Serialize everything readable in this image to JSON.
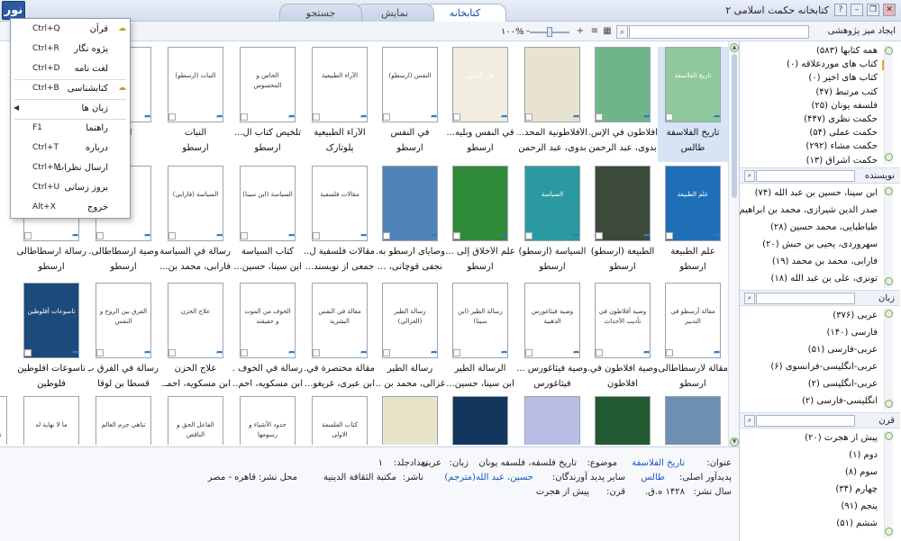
{
  "app": {
    "title": "کتابخانه حکمت اسلامی ۲",
    "logo": "نور",
    "tabs": [
      {
        "label": "کتابخانه",
        "active": true
      },
      {
        "label": "نمایش",
        "active": false
      },
      {
        "label": "جستجو",
        "active": false
      }
    ],
    "window_buttons": [
      "?",
      "–",
      "❐",
      "✕"
    ]
  },
  "toolbar": {
    "title": "ایجاد میز پژوهشی",
    "zoom_label": "۱۰۰%",
    "zoom_level": 0.5,
    "search_placeholder": ""
  },
  "books": [
    [
      {
        "title": "تاریخ الفلاسفة",
        "author": "طالس",
        "cover": "#8fc89a",
        "cover_text": "تاريخ الفلاسفة",
        "selected": true
      },
      {
        "title": "أفلاطون في الإس...",
        "author": "بدوی، عبد الرحمن",
        "cover": "#6fb58a",
        "cover_text": "",
        "selected": false
      },
      {
        "title": "الأفلاطونية المحد...",
        "author": "بدوی، عبد الرحمن",
        "cover": "#e8e2d0",
        "cover_text": "",
        "selected": false
      },
      {
        "title": "في النفس وبليه...",
        "author": "ارسطو",
        "cover": "#f1ede0",
        "cover_text": "في النفس",
        "selected": false
      },
      {
        "title": "في النفس",
        "author": "ارسطو",
        "cover": "#ffffff",
        "cover_text": "النفس (ارسطو)",
        "selected": false
      },
      {
        "title": "الآراء الطبیعیة",
        "author": "پلوتارک",
        "cover": "#ffffff",
        "cover_text": "الآراء الطبيعية",
        "selected": false
      },
      {
        "title": "تلخیص کتاب ال...",
        "author": "ارسطو",
        "cover": "#ffffff",
        "cover_text": "الحاس و المحسوس",
        "selected": false
      },
      {
        "title": "النبات",
        "author": "ارسطو",
        "cover": "#ffffff",
        "cover_text": "النبات (ارسطو)",
        "selected": false
      },
      {
        "title": "أرسـ",
        "author": "بدو",
        "cover": "#ffffff",
        "cover_text": "",
        "selected": false
      }
    ],
    [
      {
        "title": "علم الطبیعة",
        "author": "ارسطو",
        "cover": "#1f6fb8",
        "cover_text": "علم الطبيعة",
        "selected": false
      },
      {
        "title": "الطبیعة (أرسطو)",
        "author": "ارسطو",
        "cover": "#3c4a3a",
        "cover_text": "",
        "selected": false
      },
      {
        "title": "السیاسة (أرسطو)",
        "author": "ارسطو",
        "cover": "#2a9aa0",
        "cover_text": "السياسة",
        "selected": false
      },
      {
        "title": "علم الأخلاق إلى ...",
        "author": "ارسطو",
        "cover": "#2f8a3a",
        "cover_text": "",
        "selected": false
      },
      {
        "title": "وصایای ارسطو به...",
        "author": "نجفی قوچانی، ...",
        "cover": "#4f84b8",
        "cover_text": "",
        "selected": false
      },
      {
        "title": "مقالات فلسفیة ل...",
        "author": "جمعی از نویسند...",
        "cover": "#ffffff",
        "cover_text": "مقالات فلسفية",
        "selected": false
      },
      {
        "title": "کتاب السیاسة",
        "author": "ابن سینا، حسین...",
        "cover": "#ffffff",
        "cover_text": "السياسة (ابن سينا)",
        "selected": false
      },
      {
        "title": "رسالة في السیاسة",
        "author": "فارابی، محمد بن...",
        "cover": "#ffffff",
        "cover_text": "السياسة (فارابي)",
        "selected": false
      },
      {
        "title": "وصیة ارسطاطالی...",
        "author": "ارسطو",
        "cover": "#ffffff",
        "cover_text": "",
        "selected": false
      },
      {
        "title": "رسالة ارسطاطالی...",
        "author": "ارسطو",
        "cover": "#ffffff",
        "cover_text": "",
        "selected": false
      }
    ],
    [
      {
        "title": "مقالة لارسطاطالی...",
        "author": "ارسطو",
        "cover": "#ffffff",
        "cover_text": "مقالة أرسطو في التدبير",
        "selected": false
      },
      {
        "title": "وصیة افلاطون في...",
        "author": "افلاطون",
        "cover": "#ffffff",
        "cover_text": "وصية أفلاطون في تأديب الأحداث",
        "selected": false
      },
      {
        "title": "وصیة فیثاغورس ...",
        "author": "فیثاغورس",
        "cover": "#ffffff",
        "cover_text": "وصية فيثاغورس الذهبية",
        "selected": false
      },
      {
        "title": "الرسالة الطیر",
        "author": "ابن سینا، حسین...",
        "cover": "#ffffff",
        "cover_text": "رسالة الطير (ابن سينا)",
        "selected": false
      },
      {
        "title": "رسالة الطیر",
        "author": "غزالی، محمد بن ...",
        "cover": "#ffffff",
        "cover_text": "رسالة الطير (الغزالي)",
        "selected": false
      },
      {
        "title": "مقالة مختصرة في...",
        "author": "ابن عبری، غریغو...",
        "cover": "#ffffff",
        "cover_text": "مقالة في النفس البشرية",
        "selected": false
      },
      {
        "title": "رسالة في الخوف ...",
        "author": "ابن مسکویه، احم...",
        "cover": "#ffffff",
        "cover_text": "الخوف من الموت و حقيقته",
        "selected": false
      },
      {
        "title": "علاج الحزن",
        "author": "ابن مسکویه، احمـ...",
        "cover": "#ffffff",
        "cover_text": "علاج الحزن",
        "selected": false
      },
      {
        "title": "رسالة في الفرق ب...",
        "author": "قسطا بن لوقا",
        "cover": "#ffffff",
        "cover_text": "الفرق بين الروح و النفس",
        "selected": false
      },
      {
        "title": "تاسوعات أفلوطین",
        "author": "فلوطین",
        "cover": "#1c4a7a",
        "cover_text": "تاسوعات أفلوطين",
        "selected": false
      }
    ],
    [
      {
        "title": "",
        "author": "",
        "cover": "#6f8fb0",
        "cover_text": "",
        "selected": false
      },
      {
        "title": "",
        "author": "",
        "cover": "#235a32",
        "cover_text": "",
        "selected": false
      },
      {
        "title": "",
        "author": "",
        "cover": "#b9bde6",
        "cover_text": "",
        "selected": false
      },
      {
        "title": "",
        "author": "",
        "cover": "#13365e",
        "cover_text": "",
        "selected": false
      },
      {
        "title": "",
        "author": "",
        "cover": "#e9e3c9",
        "cover_text": "",
        "selected": false
      },
      {
        "title": "",
        "author": "",
        "cover": "#ffffff",
        "cover_text": "كتاب الفلسفة الاولى",
        "selected": false
      },
      {
        "title": "",
        "author": "",
        "cover": "#ffffff",
        "cover_text": "حدود الأشياء و رسومها",
        "selected": false
      },
      {
        "title": "",
        "author": "",
        "cover": "#ffffff",
        "cover_text": "الفاعل الحق و الناقص",
        "selected": false
      },
      {
        "title": "",
        "author": "",
        "cover": "#ffffff",
        "cover_text": "تناهي جرم العالم",
        "selected": false
      },
      {
        "title": "",
        "author": "",
        "cover": "#ffffff",
        "cover_text": "ما لا نهاية له",
        "selected": false
      },
      {
        "title": "",
        "author": "",
        "cover": "#ffffff",
        "cover_text": "وحدانية الله و تناهي جرم العالم",
        "selected": false
      }
    ]
  ],
  "details": {
    "title_label": "عنوان:",
    "title_value": "تاریخ الفلاسفة",
    "subject_label": "موضوع:",
    "subject_value": "تاریخ فلسفه، فلسفه یونان",
    "lang_label": "زبان:",
    "lang_value": "عربی",
    "author_label": "پدیدآور اصلی:",
    "author_value": "طالس",
    "other_label": "سایر پدید آورندگان:",
    "other_value": "حسین، عبد الله(مترجم)",
    "publisher_label": "ناشر:",
    "publisher_value": "مکتبة الثقافة الدینیة",
    "place_label": "محل نشر:",
    "place_value": "قاهره - مصر",
    "volumes_label": "تعدادجلد:",
    "volumes_value": "۱",
    "year_label": "سال نشر:",
    "year_value": "۱۴۲۸ ه.ق.",
    "century_label": "قرن:",
    "century_value": "پیش از هجرت"
  },
  "right_panel": {
    "collections": [
      {
        "label": "همه کتابها (۵۸۳)",
        "icon": "books-icon"
      },
      {
        "label": "کتاب های موردعلاقه (۰)",
        "icon": "star-icon"
      },
      {
        "label": "کتاب های اخیر (۰)",
        "icon": "recent-icon"
      },
      {
        "label": "کتب مرتبط (۴۷)",
        "icon": "related-icon"
      },
      {
        "label": "فلسفه یونان (۲۵)",
        "icon": "book-icon"
      },
      {
        "label": "حکمت نظری (۴۴۷)",
        "icon": "book-icon"
      },
      {
        "label": "حکمت عملی (۵۴)",
        "icon": "book-icon"
      },
      {
        "label": "حکمت مشاء (۲۹۲)",
        "icon": "book-icon"
      },
      {
        "label": "حکمت اشراق (۱۳)",
        "icon": "book-icon"
      }
    ],
    "author_header": "نویسنده",
    "authors": [
      "ابن سینا، حسین بن عبد الله (۷۴)",
      "صدر الدین شیرازی، محمد بن ابراهیم",
      "طباطبایی، محمد حسین (۲۸)",
      "سهروردی، یحیی بن حبش (۲۰)",
      "فارابی، محمد بن محمد (۱۹)",
      "تونزی، علی بن عبد الله (۱۸)"
    ],
    "lang_header": "زبان",
    "languages": [
      "عربی (۳۷۶)",
      "فارسی (۱۴۰)",
      "عربی-فارسی (۵۱)",
      "عربی-انگلیسی-فرانسوی (۶)",
      "عربی-انگلیسی (۲)",
      "انگلیسی-فارسی (۲)"
    ],
    "century_header": "قرن",
    "centuries": [
      "پیش از هجرت (۲۰)",
      "دوم (۱)",
      "سوم (۸)",
      "چهارم (۳۴)",
      "پنجم (۹۱)",
      "ششم (۵۱)"
    ]
  },
  "menu": {
    "items": [
      {
        "label": "قرآن",
        "shortcut": "Ctrl+Q",
        "icon": "quran-icon",
        "submenu": false
      },
      {
        "label": "پژوه نگار",
        "shortcut": "Ctrl+R",
        "icon": "",
        "submenu": false
      },
      {
        "label": "لغت نامه",
        "shortcut": "Ctrl+D",
        "icon": "",
        "submenu": false
      },
      {
        "label": "کتابشناسی",
        "shortcut": "Ctrl+B",
        "icon": "bibliography-icon",
        "submenu": false
      },
      {
        "label": "زبان ها",
        "shortcut": "",
        "icon": "",
        "submenu": true
      },
      {
        "label": "راهنما",
        "shortcut": "F1",
        "icon": "",
        "submenu": false
      },
      {
        "label": "درباره",
        "shortcut": "Ctrl+T",
        "icon": "",
        "submenu": false
      },
      {
        "label": "ارسال نظرات",
        "shortcut": "Ctrl+M",
        "icon": "",
        "submenu": false
      },
      {
        "label": "بروز رسانی",
        "shortcut": "Ctrl+U",
        "icon": "",
        "submenu": false
      },
      {
        "label": "خروج",
        "shortcut": "Alt+X",
        "icon": "",
        "submenu": false
      }
    ]
  }
}
